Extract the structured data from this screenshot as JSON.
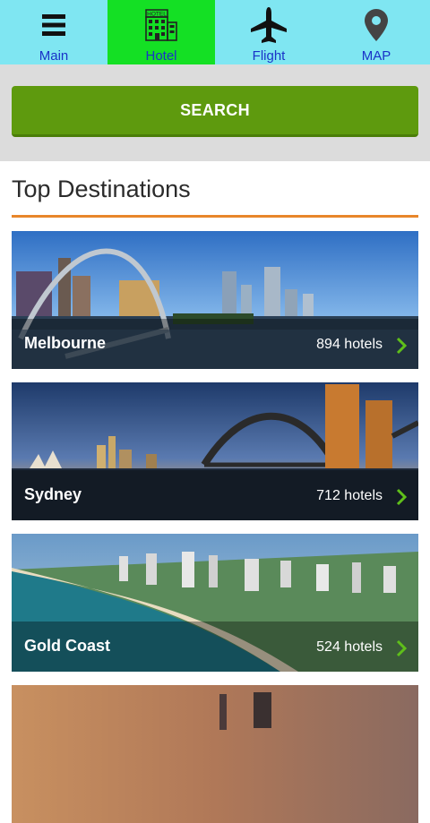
{
  "nav": {
    "items": [
      {
        "label": "Main",
        "icon": "menu-icon"
      },
      {
        "label": "Hotel",
        "icon": "hotel-icon",
        "active": true,
        "sign": "HOTEL"
      },
      {
        "label": "Flight",
        "icon": "airplane-icon"
      },
      {
        "label": "MAP",
        "icon": "map-pin-icon"
      }
    ]
  },
  "search": {
    "label": "SEARCH"
  },
  "section": {
    "title": "Top Destinations"
  },
  "destinations": [
    {
      "name": "Melbourne",
      "count": "894 hotels"
    },
    {
      "name": "Sydney",
      "count": "712 hotels"
    },
    {
      "name": "Gold Coast",
      "count": "524 hotels"
    },
    {
      "name": "",
      "count": ""
    }
  ],
  "colors": {
    "nav_bg": "#7fe6f2",
    "nav_active": "#14e024",
    "nav_label": "#1a33c8",
    "search_button": "#5e9a0e",
    "accent_rule": "#e8862a",
    "arrow": "#5fbf1a"
  }
}
